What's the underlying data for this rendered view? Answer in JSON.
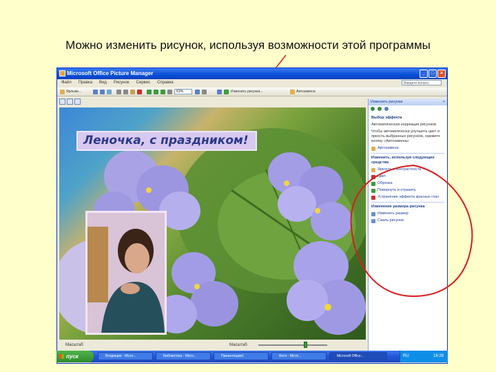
{
  "caption": "Можно изменить рисунок, используя возможности этой программы",
  "window": {
    "title": "Microsoft Office Picture Manager",
    "minimize": "_",
    "maximize": "□",
    "close": "×"
  },
  "menu": [
    "Файл",
    "Правка",
    "Вид",
    "Рисунок",
    "Сервис",
    "Справка"
  ],
  "help_placeholder": "Введите вопрос",
  "toolbar": {
    "shortcuts_label": "Ярлыки...",
    "zoom_value": "61%",
    "edit_pictures_label": "Изменить рисунки...",
    "auto_correct_label": "Автозамена"
  },
  "photo": {
    "greeting": "Леночка, с праздником!"
  },
  "status_bar": {
    "label": "Масштаб",
    "zoom_label": "Масштаб",
    "zoom_fraction": 0.68
  },
  "task_pane": {
    "title": "Изменить рисунки",
    "section1_head": "Выбор эффекта",
    "auto_correct_text": "Автоматическая коррекция рисунков",
    "auto_correct_desc": "Чтобы автоматически улучшить цвет и яркость выбранных рисунков, нажмите кнопку «Автозамена»",
    "auto_correct_button": "Автозамена",
    "section2_head": "Изменить, используя следующие средства",
    "edit_tools": [
      "Яркость и контрастность",
      "Цвет",
      "Обрезка",
      "Повернуть и отразить",
      "Устранение эффекта красных глаз"
    ],
    "section3_head": "Изменение размера рисунка",
    "resize_tools": [
      "Изменить размер",
      "Сжать рисунки"
    ]
  },
  "taskbar": {
    "start_label": "пуск",
    "tasks": [
      "Входящие - Micro...",
      "Библиотека - Micro...",
      "Презентация1",
      "Фото - Micro...",
      "Microsoft Office..."
    ],
    "language": "RU",
    "clock": "16:28"
  }
}
